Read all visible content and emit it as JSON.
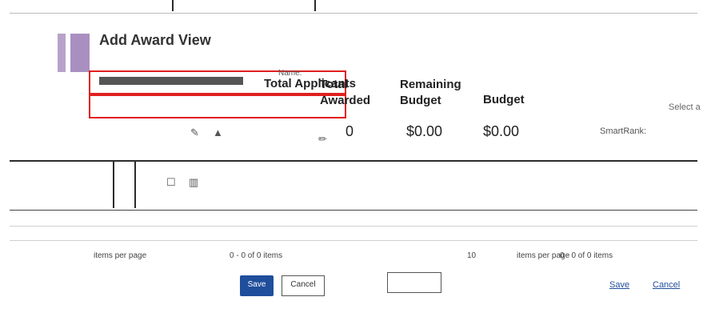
{
  "dialog": {
    "title": "Add Award View"
  },
  "summary": {
    "name_label": "Name:",
    "total_applicants_label": "Total Applicants",
    "total_applicants_value": "0",
    "total_awarded_label": "Total Awarded",
    "total_awarded_value": "0",
    "remaining_budget_label": "Remaining Budget",
    "remaining_budget_value": "$0.00",
    "budget_label": "Budget",
    "budget_value": "$0.00",
    "smartrank_label": "SmartRank:",
    "select_placeholder": "Select a"
  },
  "table": {
    "column_names": "Total Applicants",
    "toolbar_icons": [
      "edit-icon",
      "columns-icon"
    ]
  },
  "pagination": {
    "items_per_page_left": "items per page",
    "items_range_left": "0 - 0 of 0 items",
    "page_size": "10",
    "items_per_page_right": "items per page",
    "items_range_right": "0 - 0 of 0 items"
  },
  "footer": {
    "save_label": "Save",
    "cancel_label": "Cancel",
    "bottom_save_label": "Save"
  }
}
